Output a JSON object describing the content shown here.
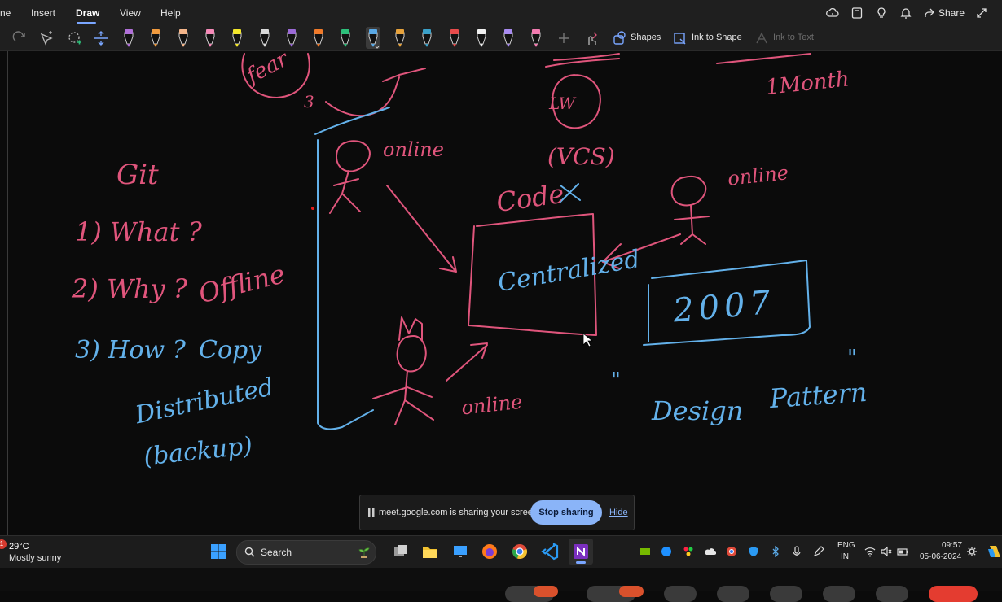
{
  "menu": {
    "items": [
      "ne",
      "Insert",
      "Draw",
      "View",
      "Help"
    ],
    "active": "Draw",
    "share_label": "Share"
  },
  "toolbar": {
    "shapes_label": "Shapes",
    "ink_to_shape_label": "Ink to Shape",
    "ink_to_text_label": "Ink to Text",
    "pens": [
      {
        "color": "#b070d8",
        "tip": "#b070d8"
      },
      {
        "color": "#f09a3e",
        "tip": "#f09a3e"
      },
      {
        "color": "#f4b58a",
        "tip": "#f4b58a"
      },
      {
        "color": "#f58ab8",
        "tip": "#f58ab8"
      },
      {
        "color": "#f2e62a",
        "tip": "#f2e62a"
      },
      {
        "color": "#d9d9d9",
        "tip": "#d9d9d9"
      },
      {
        "color": "#9b6ad6",
        "tip": "#9b6ad6"
      },
      {
        "color": "#f07a2a",
        "tip": "#f07a2a"
      },
      {
        "color": "#2dbf7a",
        "tip": "#2dbf7a"
      },
      {
        "color": "#5aa9e6",
        "tip": "#5aa9e6"
      },
      {
        "color": "#e6a23c",
        "tip": "#e6a23c"
      },
      {
        "color": "#3aa0c8",
        "tip": "#3aa0c8"
      },
      {
        "color": "#e84b4b",
        "tip": "#e84b4b"
      },
      {
        "color": "#f0f0f0",
        "tip": "#f0f0f0"
      },
      {
        "color": "#a88bf0",
        "tip": "#a88bf0"
      },
      {
        "color": "#f27bb0",
        "tip": "#f27bb0"
      }
    ]
  },
  "canvas": {
    "ink_pink": "#e0557c",
    "ink_blue": "#63b1ea",
    "words": {
      "fear": "fear",
      "three": "3",
      "one_month": "1Month",
      "lw": "LW",
      "vcs": "(VCS)",
      "code": "Code",
      "git": "Git",
      "what": "1) What ?",
      "why": "2) Why ?",
      "offline": "Offline",
      "how": "3) How ?",
      "copy": "Copy",
      "distributed": "Distributed",
      "backup": "(backup)",
      "online1": "online",
      "online2": "online",
      "online3": "online",
      "centralized": "Centralized",
      "year": "2007",
      "quote_open": "\"",
      "design": "Design",
      "pattern": "Pattern",
      "quote_close": "\""
    }
  },
  "sharebar": {
    "message": "meet.google.com is sharing your screen.",
    "stop_label": "Stop sharing",
    "hide_label": "Hide"
  },
  "taskbar": {
    "weather": {
      "temp": "29°C",
      "desc": "Mostly sunny",
      "badge": "1"
    },
    "search_label": "Search",
    "lang1": "ENG",
    "lang2": "IN",
    "time": "09:57",
    "date": "05-06-2024"
  }
}
